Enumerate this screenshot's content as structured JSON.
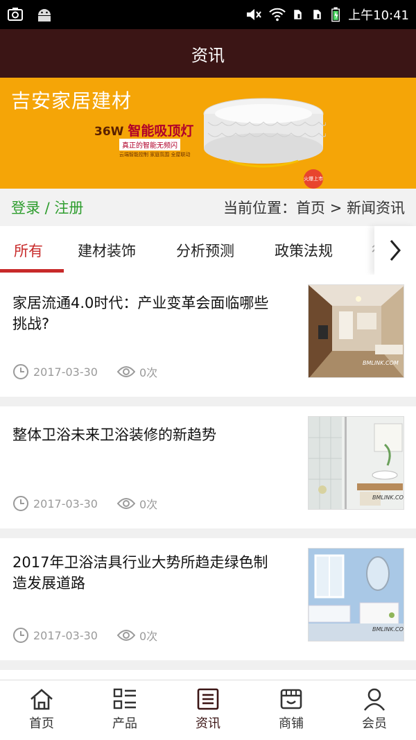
{
  "status_bar": {
    "time": "上午10:41",
    "icons": [
      "screenshot-icon",
      "android-icon",
      "mute-icon",
      "wifi-icon",
      "sim1-icon",
      "sim2-icon",
      "battery-icon"
    ]
  },
  "header": {
    "title": "资讯"
  },
  "banner": {
    "title": "吉安家居建材",
    "product_prefix": "36W",
    "product_highlight": "智能吸顶灯",
    "slogan": "真正的智能无频闪",
    "small_text": "云端智能控制  家庭氛围 全屋联动",
    "badge": "火爆上市"
  },
  "location_bar": {
    "login_link": "登录 / 注册",
    "breadcrumb": "当前位置：首页 > 新闻资讯"
  },
  "tabs": [
    {
      "label": "所有",
      "active": true
    },
    {
      "label": "建材装饰"
    },
    {
      "label": "分析预测"
    },
    {
      "label": "政策法规"
    },
    {
      "label": "行"
    }
  ],
  "articles": [
    {
      "title": "家居流通4.0时代：产业变革会面临哪些挑战?",
      "date": "2017-03-30",
      "views": "0次",
      "thumb_caption": "BMLINK.COM"
    },
    {
      "title": "整体卫浴未来卫浴装修的新趋势",
      "date": "2017-03-30",
      "views": "0次",
      "thumb_caption": "BMLINK.COM"
    },
    {
      "title": "2017年卫浴洁具行业大势所趋走绿色制造发展道路",
      "date": "2017-03-30",
      "views": "0次",
      "thumb_caption": "BMLINK.COM"
    }
  ],
  "bottom_nav": [
    {
      "label": "首页",
      "icon": "home-icon"
    },
    {
      "label": "产品",
      "icon": "grid-list-icon"
    },
    {
      "label": "资讯",
      "icon": "news-icon",
      "active": true
    },
    {
      "label": "商铺",
      "icon": "store-icon"
    },
    {
      "label": "会员",
      "icon": "user-icon"
    }
  ],
  "colors": {
    "header_bg": "#3b1515",
    "banner_bg": "#f5a507",
    "accent_red": "#c82a2a",
    "login_green": "#2e9d2e"
  }
}
